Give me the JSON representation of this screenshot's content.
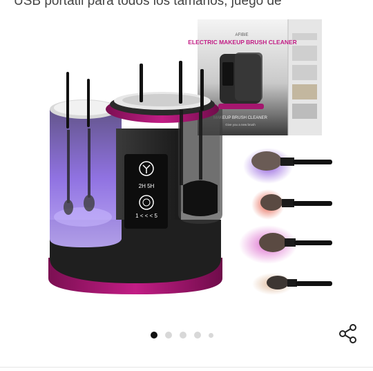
{
  "product": {
    "title_text": "USB portátil para todos los tamaños, juego de"
  },
  "image": {
    "box_brand": "AFIBIE",
    "box_title": "ELECTRIC MAKEUP BRUSH CLEANER",
    "box_subtitle_1": "MAKEUP BRUSH CLEANER",
    "box_subtitle_2": "Give you a new brush",
    "panel_hours": "2H   5H",
    "panel_speed": "1  < < <  5"
  },
  "gallery": {
    "total_images": 5,
    "active_index": 0
  },
  "icons": {
    "share": "share-icon"
  },
  "colors": {
    "accent_magenta": "#a4166e",
    "device_body": "#2b2b2b",
    "glow_purple": "#8a6be0"
  }
}
